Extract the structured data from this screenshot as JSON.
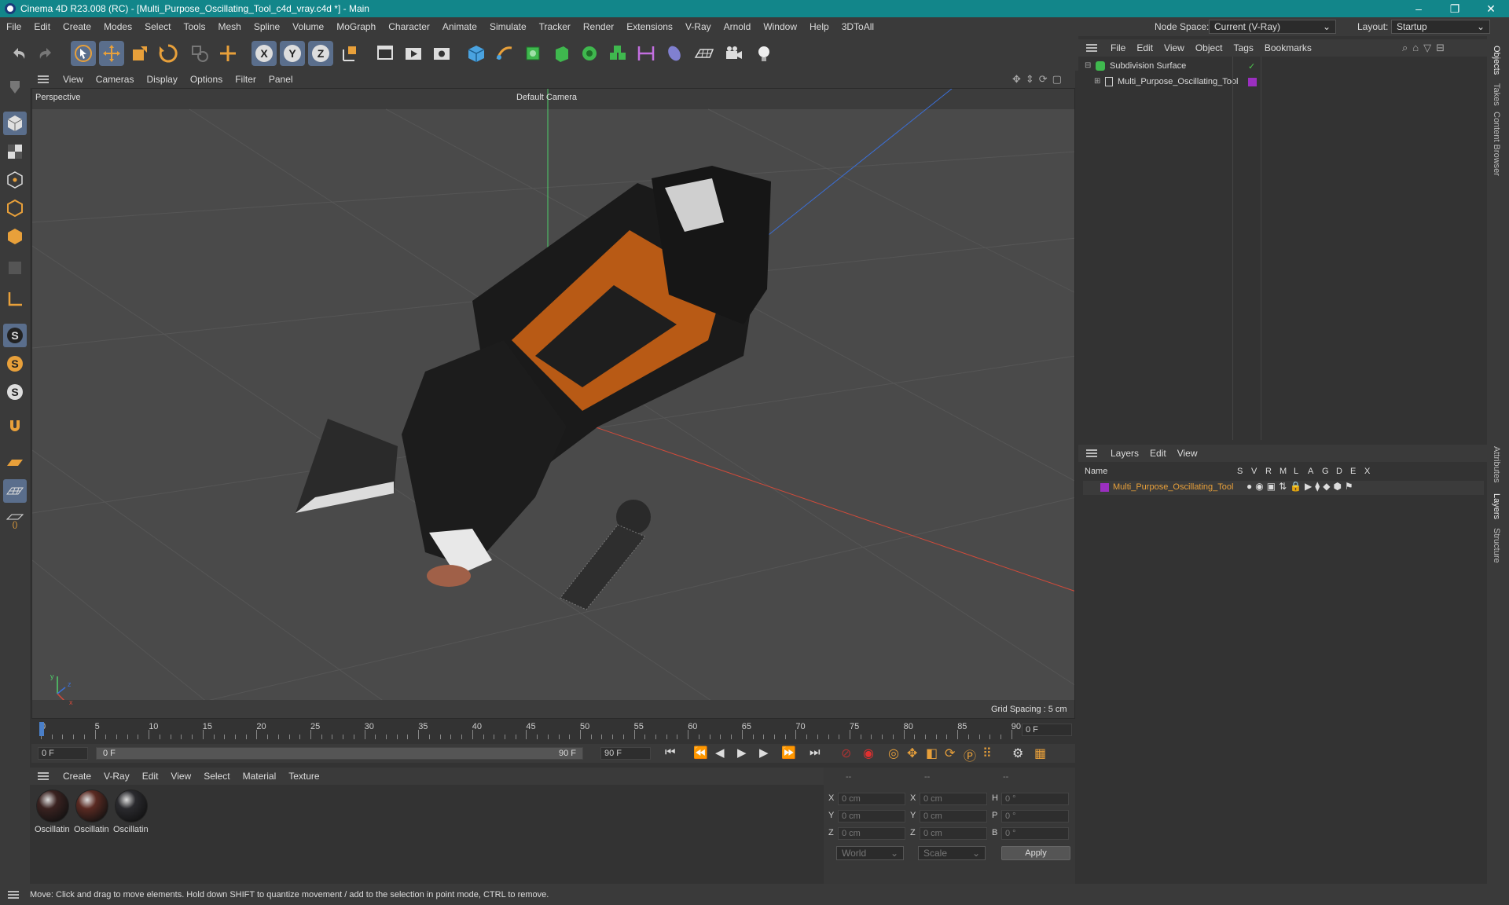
{
  "window": {
    "title": "Cinema 4D R23.008 (RC) - [Multi_Purpose_Oscillating_Tool_c4d_vray.c4d *] - Main",
    "minimize": "–",
    "restore": "❐",
    "close": "✕"
  },
  "menu": {
    "items": [
      "File",
      "Edit",
      "Create",
      "Modes",
      "Select",
      "Tools",
      "Mesh",
      "Spline",
      "Volume",
      "MoGraph",
      "Character",
      "Animate",
      "Simulate",
      "Tracker",
      "Render",
      "Extensions",
      "V-Ray",
      "Arnold",
      "Window",
      "Help",
      "3DToAll"
    ],
    "node_space_label": "Node Space:",
    "node_space_value": "Current (V-Ray)",
    "layout_label": "Layout:",
    "layout_value": "Startup"
  },
  "viewport": {
    "menu": [
      "View",
      "Cameras",
      "Display",
      "Options",
      "Filter",
      "Panel"
    ],
    "view_name": "Perspective",
    "camera": "Default Camera",
    "grid_spacing": "Grid Spacing : 5 cm",
    "axis_x": "x",
    "axis_y": "y",
    "axis_z": "z"
  },
  "timeline": {
    "ticks": [
      "0",
      "5",
      "10",
      "15",
      "20",
      "25",
      "30",
      "35",
      "40",
      "45",
      "50",
      "55",
      "60",
      "65",
      "70",
      "75",
      "80",
      "85",
      "90"
    ],
    "current_frame": "0 F",
    "start_field": "0 F",
    "range_start": "0 F",
    "range_end": "90 F",
    "end_field": "90 F"
  },
  "materials": {
    "menu": [
      "Create",
      "V-Ray",
      "Edit",
      "View",
      "Select",
      "Material",
      "Texture"
    ],
    "items": [
      {
        "label": "Oscillatin",
        "color": "#3a2220"
      },
      {
        "label": "Oscillatin",
        "color": "#5a2a22"
      },
      {
        "label": "Oscillatin",
        "color": "#2a2a2e"
      }
    ]
  },
  "coordinates": {
    "header": [
      "--",
      "--",
      "--"
    ],
    "rows": [
      {
        "l1": "X",
        "v1": "0 cm",
        "l2": "X",
        "v2": "0 cm",
        "l3": "H",
        "v3": "0 °"
      },
      {
        "l1": "Y",
        "v1": "0 cm",
        "l2": "Y",
        "v2": "0 cm",
        "l3": "P",
        "v3": "0 °"
      },
      {
        "l1": "Z",
        "v1": "0 cm",
        "l2": "Z",
        "v2": "0 cm",
        "l3": "B",
        "v3": "0 °"
      }
    ],
    "space": "World",
    "mode": "Scale",
    "apply": "Apply"
  },
  "objects": {
    "menu": [
      "File",
      "Edit",
      "View",
      "Object",
      "Tags",
      "Bookmarks"
    ],
    "tree": [
      {
        "name": "Subdivision Surface",
        "color": "#4ec94e"
      },
      {
        "name": "Multi_Purpose_Oscillating_Tool",
        "color": "#9b2fc0"
      }
    ]
  },
  "layers": {
    "menu": [
      "Layers",
      "Edit",
      "View"
    ],
    "columns": [
      "Name",
      "S",
      "V",
      "R",
      "M",
      "L",
      "A",
      "G",
      "D",
      "E",
      "X"
    ],
    "rows": [
      {
        "name": "Multi_Purpose_Oscillating_Tool",
        "color": "#9b2fc0",
        "text_color": "#e8a03a"
      }
    ]
  },
  "side_tabs": [
    "Objects",
    "Takes",
    "Content Browser",
    "Attributes",
    "Layers",
    "Structure"
  ],
  "status": "Move: Click and drag to move elements. Hold down SHIFT to quantize movement / add to the selection in point mode, CTRL to remove."
}
